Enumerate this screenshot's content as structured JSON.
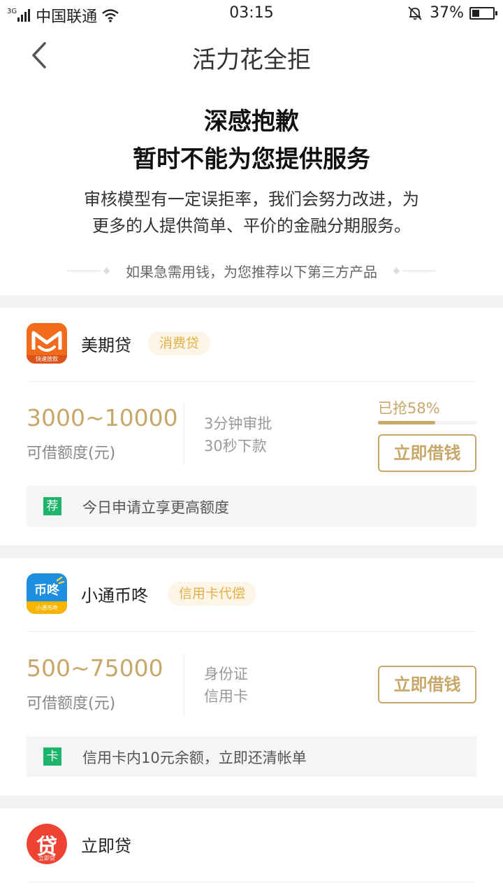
{
  "status_bar": {
    "network_type": "3G",
    "carrier": "中国联通",
    "time": "03:15",
    "battery_percent": "37%",
    "battery_level": 0.37,
    "icons": [
      "signal-icon",
      "wifi-icon",
      "mute-bell-icon",
      "battery-icon"
    ]
  },
  "nav": {
    "back_icon": "chevron-left-icon",
    "title": "活力花全拒"
  },
  "hero": {
    "title_line1": "深感抱歉",
    "title_line2": "暂时不能为您提供服务",
    "description_line1": "审核模型有一定误拒率，我们会努力改进，为",
    "description_line2": "更多的人提供简单、平价的金融分期服务。",
    "recommend_text": "如果急需用钱，为您推荐以下第三方产品"
  },
  "products": [
    {
      "name": "美期贷",
      "tag": "消费贷",
      "logo_caption": "快速放款",
      "amount": "3000~10000",
      "amount_label": "可借额度(元)",
      "feature1": "3分钟审批",
      "feature2": "30秒下款",
      "progress_text": "已抢58%",
      "progress": 0.58,
      "button": "立即借钱",
      "promo_badge": "荐",
      "promo_text": "今日申请立享更高额度"
    },
    {
      "name": "小通币咚",
      "tag": "信用卡代偿",
      "logo_text": "币咚",
      "logo_caption": "小通币咚",
      "amount": "500~75000",
      "amount_label": "可借额度(元)",
      "feature1": "身份证",
      "feature2": "信用卡",
      "button": "立即借钱",
      "promo_badge": "卡",
      "promo_text": "信用卡内10元余额，立即还清帐单"
    },
    {
      "name": "立即贷",
      "logo_text": "贷",
      "logo_caption": "立即贷"
    }
  ],
  "colors": {
    "accent_gold": "#c8a76a",
    "tag_text": "#e3b046",
    "tag_bg": "#fdf6e8",
    "promo_badge": "#1db56b",
    "section_gap": "#f3f3f5"
  }
}
